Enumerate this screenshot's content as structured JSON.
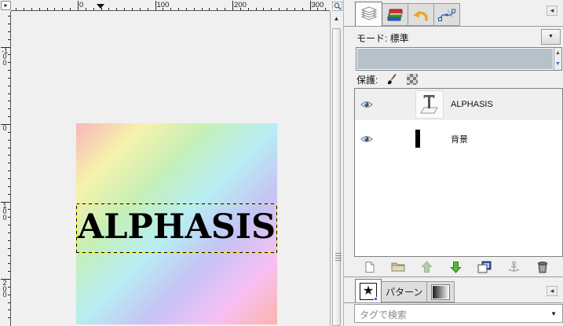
{
  "colors": {
    "dock_bg": "#f0f0f0",
    "canvas_bg": "#f0f0f0",
    "opacity_slider_fill": "#b6c2ca",
    "ant_black": "#000000",
    "ant_yellow": "#ffe800",
    "gradient_stops": [
      "#f7b6bd",
      "#f7f2ab",
      "#c6efb6",
      "#b7eef3",
      "#c5c3f5",
      "#f7c0f3",
      "#fdb3ab"
    ]
  },
  "canvas": {
    "ruler_h_labels": [
      "0",
      "100",
      "200",
      "300"
    ],
    "ruler_v_labels": [
      "-100",
      "0",
      "100",
      "200"
    ],
    "corner_button_glyph": "▸",
    "scroll_up_glyph": "▲",
    "image_text": "ALPHASIS"
  },
  "layers_dock": {
    "tabs": [
      {
        "icon": "layers-icon",
        "selected": true
      },
      {
        "icon": "channels-icon",
        "selected": false
      },
      {
        "icon": "undo-history-icon",
        "selected": false
      },
      {
        "icon": "paths-icon",
        "selected": false
      }
    ],
    "menu_button_glyph": "◂",
    "mode_label": "モード: 標準",
    "dropdown_glyph": "▼",
    "spin_up_glyph": "▲",
    "spin_down_glyph": "▼",
    "lock_label": "保護:",
    "lock_icons": [
      "paintbrush-icon",
      "checkerboard-icon"
    ],
    "layers": [
      {
        "name": "ALPHASIS",
        "thumbnail": "text-layer",
        "visible": true,
        "selected": true
      },
      {
        "name": "背景",
        "thumbnail": "gradient",
        "visible": true,
        "selected": false
      }
    ],
    "action_icons": [
      "new-layer-icon",
      "new-group-icon",
      "raise-layer-icon",
      "lower-layer-icon",
      "duplicate-layer-icon",
      "anchor-layer-icon",
      "delete-layer-icon"
    ]
  },
  "brushes_dock": {
    "tabs": [
      {
        "icon": "brush-star-icon",
        "selected": true
      },
      {
        "label": "パターン",
        "selected": false
      },
      {
        "icon": "gradient-swatch-icon",
        "selected": false
      }
    ],
    "menu_button_glyph": "◂",
    "search_placeholder": "タグで検索",
    "search_arrow_glyph": "▼"
  }
}
